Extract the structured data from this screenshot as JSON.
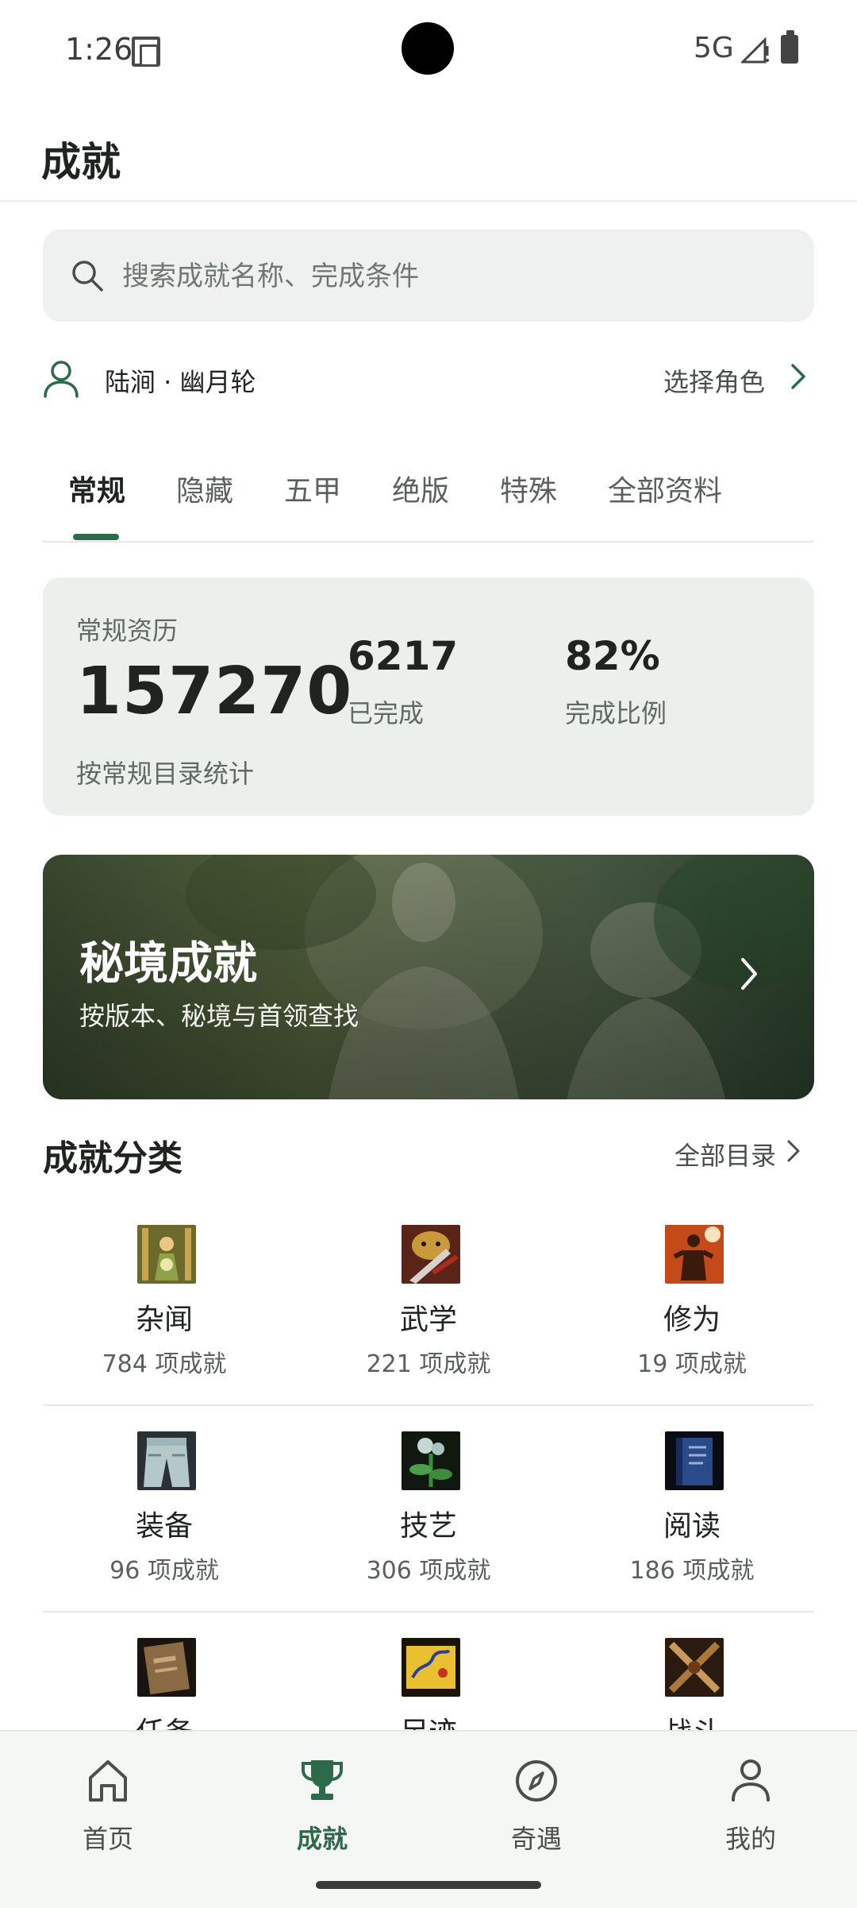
{
  "status_bar": {
    "time": "1:26",
    "network": "5G"
  },
  "header": {
    "title": "成就"
  },
  "search": {
    "placeholder": "搜索成就名称、完成条件"
  },
  "role": {
    "name": "陆涧 · 幽月轮",
    "select_label": "选择角色"
  },
  "tabs": [
    {
      "label": "常规",
      "active": true
    },
    {
      "label": "隐藏"
    },
    {
      "label": "五甲"
    },
    {
      "label": "绝版"
    },
    {
      "label": "特殊"
    },
    {
      "label": "全部资料"
    }
  ],
  "stats": {
    "label": "常规资历",
    "total": "157270",
    "note": "按常规目录统计",
    "completed_value": "6217",
    "completed_label": "已完成",
    "ratio_value": "82%",
    "ratio_label": "完成比例"
  },
  "banner": {
    "title": "秘境成就",
    "subtitle": "按版本、秘境与首领查找"
  },
  "categories_section": {
    "title": "成就分类",
    "link": "全部目录"
  },
  "categories": [
    {
      "name": "杂闻",
      "count": "784 项成就",
      "icon": "scroll-figure-icon"
    },
    {
      "name": "武学",
      "count": "221 项成就",
      "icon": "dragon-blade-icon"
    },
    {
      "name": "修为",
      "count": "19 项成就",
      "icon": "glowing-warrior-icon"
    },
    {
      "name": "装备",
      "count": "96 项成就",
      "icon": "trousers-icon"
    },
    {
      "name": "技艺",
      "count": "306 项成就",
      "icon": "herb-plant-icon"
    },
    {
      "name": "阅读",
      "count": "186 项成就",
      "icon": "blue-book-icon"
    },
    {
      "name": "任务",
      "count": "",
      "icon": "brown-book-icon"
    },
    {
      "name": "足迹",
      "count": "",
      "icon": "yellow-map-icon"
    },
    {
      "name": "战斗",
      "count": "",
      "icon": "crossed-swords-icon"
    }
  ],
  "nav": [
    {
      "label": "首页",
      "icon": "home-icon"
    },
    {
      "label": "成就",
      "icon": "trophy-icon",
      "active": true
    },
    {
      "label": "奇遇",
      "icon": "compass-icon"
    },
    {
      "label": "我的",
      "icon": "user-icon"
    }
  ],
  "colors": {
    "accent": "#2c6a4b",
    "card_bg": "#ebf0ed",
    "search_bg": "#eef1ef"
  }
}
